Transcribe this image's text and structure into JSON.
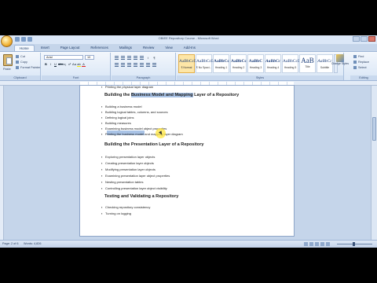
{
  "window_title": "OBIEE Repository Course - Microsoft Word",
  "tabs": [
    "Home",
    "Insert",
    "Page Layout",
    "References",
    "Mailings",
    "Review",
    "View",
    "Add-Ins"
  ],
  "ribbon": {
    "clipboard": {
      "label": "Clipboard",
      "paste": "Paste",
      "cut": "Cut",
      "copy": "Copy",
      "format_painter": "Format Painter"
    },
    "font": {
      "label": "Font",
      "font_name": "Arial",
      "font_size": "10"
    },
    "paragraph": {
      "label": "Paragraph"
    },
    "styles": {
      "label": "Styles",
      "items": [
        {
          "sample": "AaBbCcDc",
          "name": "¶ Normal"
        },
        {
          "sample": "AaBbCcDc",
          "name": "¶ No Spaci..."
        },
        {
          "sample": "AaBbCc",
          "name": "Heading 1"
        },
        {
          "sample": "AaBbCc",
          "name": "Heading 2"
        },
        {
          "sample": "AaBbC",
          "name": "Heading 3"
        },
        {
          "sample": "AaBbCc",
          "name": "Heading 4"
        },
        {
          "sample": "AaBbCcD",
          "name": "Heading 5"
        },
        {
          "sample": "AaB",
          "name": "Title"
        },
        {
          "sample": "AaBbCc",
          "name": "Subtitle"
        }
      ],
      "change_styles": "Change Styles"
    },
    "editing": {
      "label": "Editing",
      "find": "Find",
      "replace": "Replace",
      "select": "Select"
    }
  },
  "document": {
    "top_bullet": "Printing the physical layer diagram",
    "sections": [
      {
        "heading_pre": "Building the ",
        "heading_sel": "Business Model and Mapping",
        "heading_post": " Layer of a Repository",
        "bullets": [
          "Building a business model",
          "Building logical tables, columns, and sources",
          "Defining logical joins",
          "Building measures",
          "Examining business model object properties",
          "Printing the business model and mapping layer diagram"
        ]
      },
      {
        "heading": "Building the Presentation  Layer of a Repository",
        "bullets": [
          "Exploring presentation layer objects",
          "Creating presentation layer objects",
          "Modifying presentation layer objects",
          "Examining presentation layer object properties",
          "Nesting presentation tables",
          "Controlling presentation layer object visibility"
        ]
      },
      {
        "heading": "Testing and Validating  a Repository",
        "bullets": [
          "Checking repository consistency",
          "Turning on logging"
        ]
      }
    ]
  },
  "status": {
    "page": "Page: 2 of 6",
    "words": "Words: 4,826"
  }
}
